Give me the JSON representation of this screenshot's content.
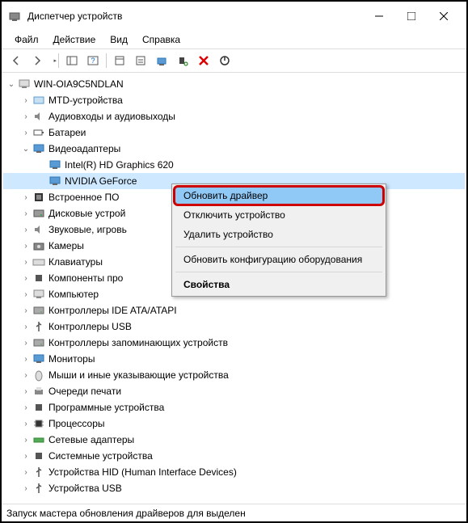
{
  "window": {
    "title": "Диспетчер устройств"
  },
  "menubar": {
    "file": "Файл",
    "action": "Действие",
    "view": "Вид",
    "help": "Справка"
  },
  "tree": {
    "root": "WIN-OIA9C5NDLAN",
    "categories": [
      {
        "label": "MTD-устройства",
        "expander": "›"
      },
      {
        "label": "Аудиовходы и аудиовыходы",
        "expander": "›"
      },
      {
        "label": "Батареи",
        "expander": "›"
      },
      {
        "label": "Видеоадаптеры",
        "expander": "⌄",
        "children": [
          {
            "label": "Intel(R) HD Graphics 620"
          },
          {
            "label": "NVIDIA GeForce",
            "selected": true
          }
        ]
      },
      {
        "label": "Встроенное ПО",
        "expander": "›"
      },
      {
        "label": "Дисковые устрой",
        "expander": "›"
      },
      {
        "label": "Звуковые, игровь",
        "expander": "›"
      },
      {
        "label": "Камеры",
        "expander": "›"
      },
      {
        "label": "Клавиатуры",
        "expander": "›"
      },
      {
        "label": "Компоненты про",
        "expander": "›"
      },
      {
        "label": "Компьютер",
        "expander": "›"
      },
      {
        "label": "Контроллеры IDE ATA/ATAPI",
        "expander": "›"
      },
      {
        "label": "Контроллеры USB",
        "expander": "›"
      },
      {
        "label": "Контроллеры запоминающих устройств",
        "expander": "›"
      },
      {
        "label": "Мониторы",
        "expander": "›"
      },
      {
        "label": "Мыши и иные указывающие устройства",
        "expander": "›"
      },
      {
        "label": "Очереди печати",
        "expander": "›"
      },
      {
        "label": "Программные устройства",
        "expander": "›"
      },
      {
        "label": "Процессоры",
        "expander": "›"
      },
      {
        "label": "Сетевые адаптеры",
        "expander": "›"
      },
      {
        "label": "Системные устройства",
        "expander": "›"
      },
      {
        "label": "Устройства HID (Human Interface Devices)",
        "expander": "›"
      },
      {
        "label": "Устройства USB",
        "expander": "›"
      }
    ]
  },
  "context_menu": {
    "update_driver": "Обновить драйвер",
    "disable_device": "Отключить устройство",
    "remove_device": "Удалить устройство",
    "refresh_config": "Обновить конфигурацию оборудования",
    "properties": "Свойства"
  },
  "statusbar": {
    "text": "Запуск мастера обновления драйверов для выделен"
  },
  "colors": {
    "highlight_border": "#c00",
    "selection_bg": "#cde8ff",
    "ctx_highlight": "#90c8f6"
  }
}
